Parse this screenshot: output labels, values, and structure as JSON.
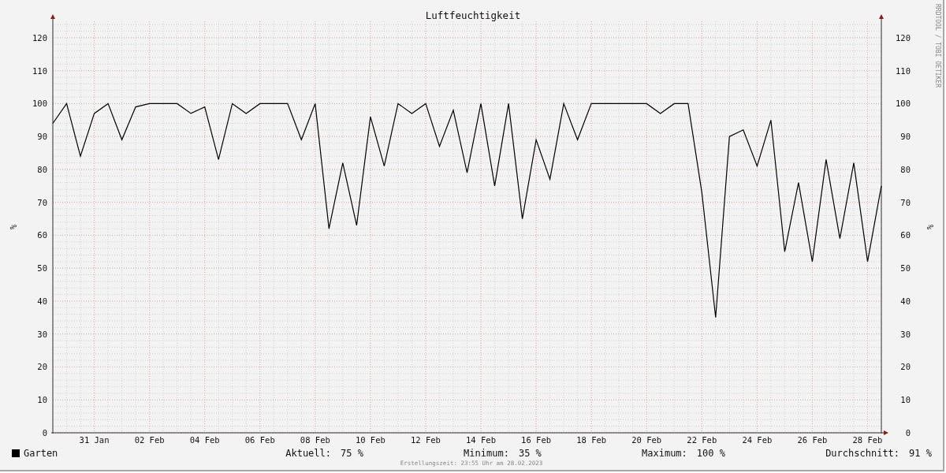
{
  "chart": {
    "chart_data": {
      "type": "line",
      "title": "Luftfeuchtigkeit",
      "ylabel": "%",
      "categories": [
        null,
        null,
        null,
        "31 Jan",
        null,
        null,
        null,
        "02 Feb",
        null,
        null,
        null,
        "04 Feb",
        null,
        null,
        null,
        "06 Feb",
        null,
        null,
        null,
        "08 Feb",
        null,
        null,
        null,
        "10 Feb",
        null,
        null,
        null,
        "12 Feb",
        null,
        null,
        null,
        "14 Feb",
        null,
        null,
        null,
        "16 Feb",
        null,
        null,
        null,
        "18 Feb",
        null,
        null,
        null,
        "20 Feb",
        null,
        null,
        null,
        "22 Feb",
        null,
        null,
        null,
        "24 Feb",
        null,
        null,
        null,
        "26 Feb",
        null,
        null,
        null,
        "28 Feb",
        null
      ],
      "series": [
        {
          "name": "Garten",
          "color": "#000000",
          "values": [
            94,
            100,
            84,
            97,
            100,
            89,
            99,
            100,
            100,
            100,
            97,
            99,
            83,
            100,
            97,
            100,
            100,
            100,
            89,
            100,
            62,
            82,
            63,
            96,
            81,
            100,
            97,
            100,
            87,
            98,
            79,
            100,
            75,
            100,
            65,
            89,
            77,
            100,
            89,
            100,
            100,
            100,
            100,
            100,
            97,
            100,
            100,
            73,
            35,
            90,
            92,
            81,
            95,
            55,
            76,
            52,
            83,
            59,
            82,
            52,
            75
          ]
        }
      ],
      "ylim": [
        0,
        125
      ],
      "grid": true,
      "yticks": [
        0,
        10,
        20,
        30,
        40,
        50,
        60,
        70,
        80,
        90,
        100,
        110,
        120
      ]
    },
    "right_ylabel": "%",
    "right_axis_labels": [
      "120",
      "110",
      "100",
      "90",
      "80",
      "70",
      "60",
      "50",
      "40",
      "30",
      "20",
      "10",
      "0"
    ],
    "credit": "RRDTOOL / TOBI OETIKER"
  },
  "legend": {
    "stats": [
      {
        "label": "Aktuell:",
        "value": "75 %"
      },
      {
        "label": "Minimum:",
        "value": "35 %"
      },
      {
        "label": "Maximum:",
        "value": "100 %"
      },
      {
        "label": "Durchschnitt:",
        "value": "91 %"
      }
    ]
  },
  "created": "Erstellungszeit: 23:55 Uhr am 28.02.2023"
}
